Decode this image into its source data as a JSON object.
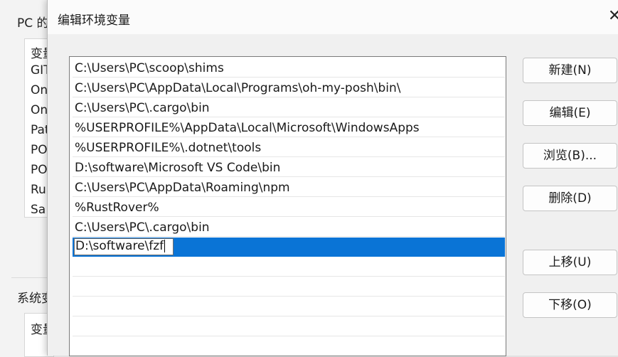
{
  "background_window": {
    "title": "PC 的",
    "user_vars": [
      "变量",
      "GIT",
      "On",
      "On",
      "Pat",
      "PO",
      "PO",
      "Ru",
      "Sa"
    ],
    "system_label": "系统变",
    "system_header": "变量"
  },
  "dialog": {
    "title": "编辑环境变量",
    "close_glyph": "✕",
    "paths": [
      "C:\\Users\\PC\\scoop\\shims",
      "C:\\Users\\PC\\AppData\\Local\\Programs\\oh-my-posh\\bin\\",
      "C:\\Users\\PC\\.cargo\\bin",
      "%USERPROFILE%\\AppData\\Local\\Microsoft\\WindowsApps",
      "%USERPROFILE%\\.dotnet\\tools",
      "D:\\software\\Microsoft VS Code\\bin",
      "C:\\Users\\PC\\AppData\\Roaming\\npm",
      "%RustRover%",
      "C:\\Users\\PC\\.cargo\\bin"
    ],
    "editing_value": "D:\\software\\fzf",
    "buttons": {
      "new": "新建(N)",
      "edit": "编辑(E)",
      "browse": "浏览(B)...",
      "delete": "删除(D)",
      "move_up": "上移(U)",
      "move_down": "下移(O)"
    }
  },
  "colors": {
    "selection": "#0a74d6",
    "dialog_bg": "#f0f0f0",
    "titlebar_bg": "#fbfbfb"
  }
}
